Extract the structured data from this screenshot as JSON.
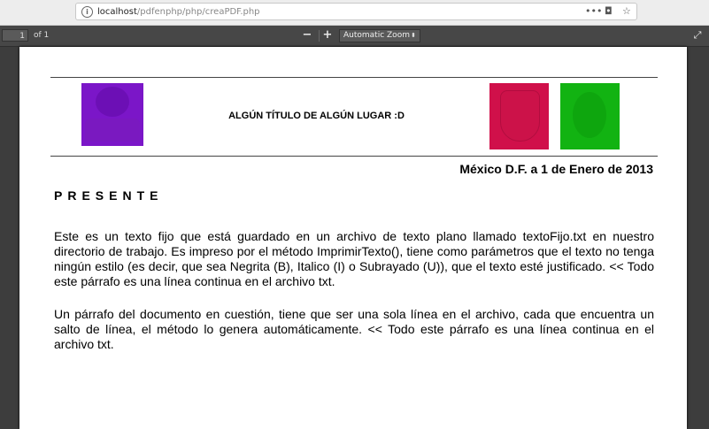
{
  "browser": {
    "url_host": "localhost",
    "url_path": "/pdfenphp/php/creaPDF.php",
    "page_actions_icon": "ellipsis-icon",
    "pocket_icon": "pocket-icon",
    "bookmark_icon": "star-icon"
  },
  "pdf_toolbar": {
    "page_number": "1",
    "page_count": "of 1",
    "zoom_out": "−",
    "zoom_in": "+",
    "zoom_label": "Automatic Zoom",
    "zoom_arrow": "▲▼"
  },
  "document": {
    "title": "ALGÚN TÍTULO DE ALGÚN LUGAR :D",
    "date_line": "México D.F. a 1 de Enero de 2013",
    "salutation": "PRESENTE",
    "paragraph1": "Este es un texto fijo que está guardado en un archivo de texto plano llamado textoFijo.txt en nuestro directorio de trabajo. Es impreso por el método ImprimirTexto(), tiene como parámetros que el texto no tenga ningún estilo (es decir, que sea Negrita (B), Italico (I) o Subrayado (U)), que el texto esté justificado. << Todo este párrafo es una línea continua en el archivo txt.",
    "paragraph2": "Un párrafo del documento en cuestión, tiene que ser una sola línea en el archivo, cada que encuentra un salto de línea, el método lo genera automáticamente. << Todo este párrafo es una línea continua en el archivo txt."
  },
  "colors": {
    "logo_left": "#7b16c8",
    "logo_red": "#d0104a",
    "logo_green": "#12b312"
  }
}
